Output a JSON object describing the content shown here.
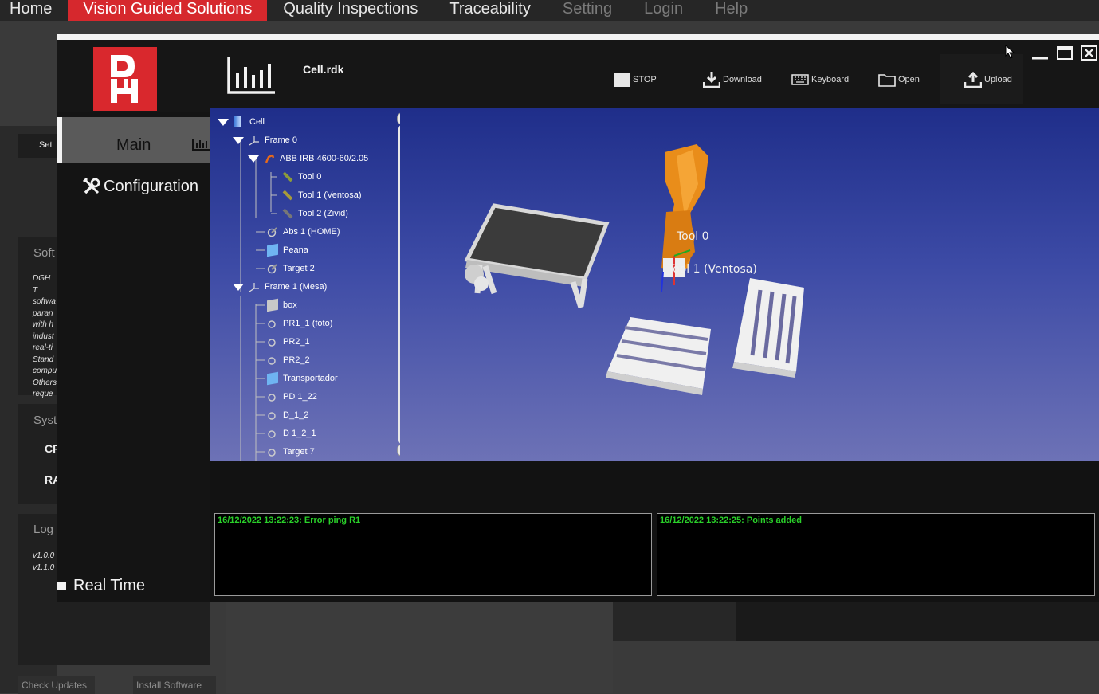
{
  "nav": {
    "home": "Home",
    "vision": "Vision Guided Solutions",
    "quality": "Quality Inspections",
    "traceability": "Traceability",
    "setting": "Setting",
    "login": "Login",
    "help": "Help"
  },
  "background": {
    "set_button": "Set",
    "software_heading": "Soft",
    "software_lines": [
      "DGH T",
      "softwa",
      "paran",
      "with h",
      "indust",
      "real-ti",
      "Stand",
      "compu",
      "Others",
      "reque"
    ],
    "system_heading": "Syst",
    "system_items": [
      "CF",
      "RA"
    ],
    "log_heading": "Log",
    "log_lines": [
      "v1.0.0",
      "v1.1.0 I"
    ],
    "check_updates": "Check Updates",
    "install_software": "Install Software"
  },
  "window": {
    "file_name": "Cell.rdk",
    "toolbar": {
      "stop": "STOP",
      "download": "Download",
      "keyboard": "Keyboard",
      "open": "Open",
      "upload": "Upload"
    },
    "left_nav": {
      "main": "Main",
      "configuration": "Configuration",
      "real_time": "Real Time"
    }
  },
  "tree": {
    "items": [
      {
        "label": "Cell",
        "icon": "cell-icon"
      },
      {
        "label": "Frame 0",
        "icon": "frame-icon"
      },
      {
        "label": "ABB IRB 4600-60/2.05",
        "icon": "robot-icon"
      },
      {
        "label": "Tool 0",
        "icon": "tool-icon"
      },
      {
        "label": "Tool 1 (Ventosa)",
        "icon": "tool-icon"
      },
      {
        "label": "Tool 2 (Zivid)",
        "icon": "tool-icon"
      },
      {
        "label": "Abs 1 (HOME)",
        "icon": "target-icon"
      },
      {
        "label": "Peana",
        "icon": "object-icon"
      },
      {
        "label": "Target 2",
        "icon": "target-icon"
      },
      {
        "label": "Frame 1 (Mesa)",
        "icon": "frame-icon"
      },
      {
        "label": "box",
        "icon": "box-icon"
      },
      {
        "label": "PR1_1 (foto)",
        "icon": "target-icon"
      },
      {
        "label": "PR2_1",
        "icon": "target-icon"
      },
      {
        "label": "PR2_2",
        "icon": "target-icon"
      },
      {
        "label": "Transportador",
        "icon": "object-icon"
      },
      {
        "label": "PD 1_22",
        "icon": "target-icon"
      },
      {
        "label": "D_1_2",
        "icon": "target-icon"
      },
      {
        "label": "D 1_2_1",
        "icon": "target-icon"
      },
      {
        "label": "Target 7",
        "icon": "target-icon"
      }
    ]
  },
  "scene": {
    "tool0_label": "Tool 0",
    "tool1_label": "Tool 1 (Ventosa)"
  },
  "logs": {
    "left": "16/12/2022 13:22:23: Error ping R1",
    "right": "16/12/2022 13:22:25: Points added"
  }
}
